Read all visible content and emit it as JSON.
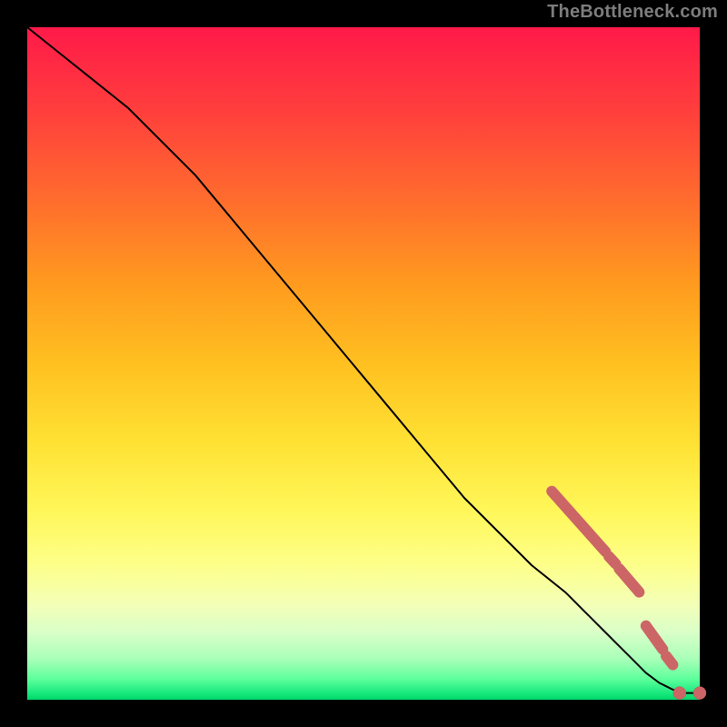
{
  "attribution": "TheBottleneck.com",
  "chart_data": {
    "type": "line",
    "title": "",
    "xlabel": "",
    "ylabel": "",
    "xlim": [
      0,
      100
    ],
    "ylim": [
      0,
      100
    ],
    "grid": false,
    "legend": false,
    "series": [
      {
        "name": "bottleneck-curve",
        "x": [
          0,
          5,
          10,
          15,
          20,
          25,
          30,
          35,
          40,
          45,
          50,
          55,
          60,
          65,
          70,
          75,
          80,
          82,
          84,
          86,
          88,
          90,
          92,
          94,
          95,
          96,
          98,
          100
        ],
        "values": [
          100,
          96,
          92,
          88,
          83,
          78,
          72,
          66,
          60,
          54,
          48,
          42,
          36,
          30,
          25,
          20,
          16,
          14,
          12,
          10,
          8,
          6,
          4,
          2.5,
          2,
          1.5,
          1,
          1
        ]
      }
    ],
    "highlight_segments": [
      {
        "x0": 78,
        "y0": 31,
        "x1": 86,
        "y1": 22
      },
      {
        "x0": 86.5,
        "y0": 21.3,
        "x1": 87.5,
        "y1": 20.2
      },
      {
        "x0": 88,
        "y0": 19.5,
        "x1": 91,
        "y1": 16
      },
      {
        "x0": 92,
        "y0": 11,
        "x1": 94.5,
        "y1": 7.5
      },
      {
        "x0": 95,
        "y0": 6.5,
        "x1": 96,
        "y1": 5.2
      }
    ],
    "highlight_points": [
      {
        "x": 97,
        "y": 1
      },
      {
        "x": 100,
        "y": 1
      }
    ],
    "colors": {
      "curve": "#000000",
      "marker": "#cc6666",
      "gradient_top": "#ff1a49",
      "gradient_mid": "#ffe234",
      "gradient_bot": "#00d768",
      "background": "#000000",
      "attribution": "#7d7d7d"
    }
  }
}
